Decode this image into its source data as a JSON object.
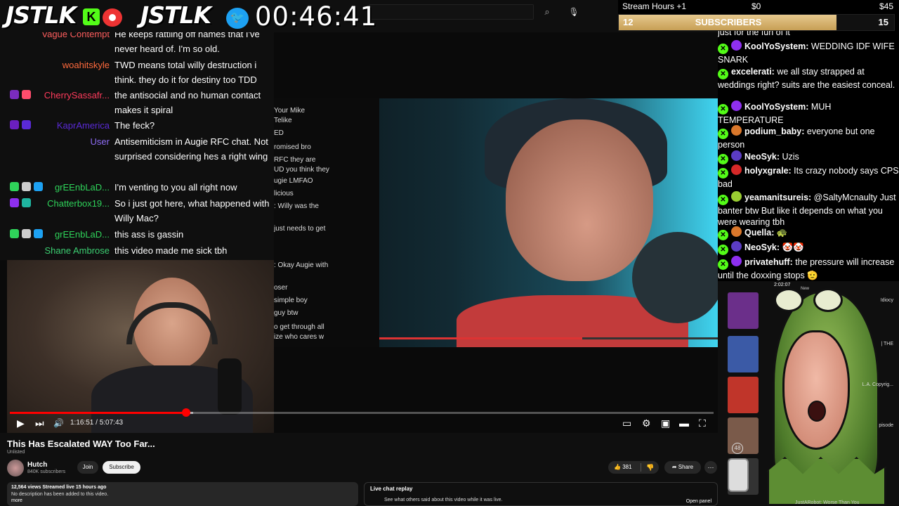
{
  "brand": {
    "left": "JSTLK",
    "right": "JSTLK",
    "kick_letter": "K",
    "twitter_bird": "🐦"
  },
  "timer": "00:46:41",
  "stream_widget": {
    "label": "Stream Hours +1",
    "min": "$0",
    "max": "$45",
    "subs_current": "12",
    "subs_label": "SUBSCRIBERS",
    "subs_goal": "15",
    "subs_progress": 0.79
  },
  "overlay_chat": [
    {
      "user": "Vague Contempt",
      "color": "#ff5e5e",
      "text": "He keeps rattling off names that I've never heard of. I'm so old.",
      "badges": []
    },
    {
      "user": "woahitskyle",
      "color": "#ff6a3d",
      "text": "TWD means total willy destruction i think. they do it for destiny too TDD",
      "badges": []
    },
    {
      "user": "CherrySassafr...",
      "color": "#ff3b5c",
      "text": "the antisocial and no human contact makes it spiral",
      "badges": [
        "#7b2cbf",
        "#ff4d6d"
      ]
    },
    {
      "user": "KaprAmerica",
      "color": "#5a2ad6",
      "text": "The feck?",
      "badges": [
        "#6a1fbf",
        "#5a2ad6"
      ]
    },
    {
      "user": "User",
      "color": "#8e6cf5",
      "text": "Antisemiticism in Augie RFC chat. Not surprised considering hes a right wing",
      "badges": []
    },
    {
      "user": "grEEnbLaD...",
      "color": "#2fd35a",
      "text": "I'm venting to you all right now",
      "badges": [
        "#2fd35a",
        "#cccccc",
        "#1da1f2"
      ]
    },
    {
      "user": "Chatterbox19...",
      "color": "#2fd35a",
      "text": "So i just got here, what happened with Willy Mac?",
      "badges": [
        "#8e2ff0",
        "#1fb5a0"
      ]
    },
    {
      "user": "grEEnbLaD...",
      "color": "#2fd35a",
      "text": "this ass is gassin",
      "badges": [
        "#2fd35a",
        "#cccccc",
        "#1da1f2"
      ]
    },
    {
      "user": "Shane Ambrose",
      "color": "#3ccf72",
      "text": "this video made me sick tbh",
      "badges": []
    }
  ],
  "video_panel_lines": [
    "Your Mike",
    "Telike",
    "ED",
    "romised bro",
    "RFC they are",
    "UD you think they",
    "ugie LMFAO",
    "licious",
    ": Willy was the",
    "just needs to get",
    ": Okay Augie with",
    "oser",
    "simple boy",
    "guy btw",
    "o get through all",
    "ize who cares w"
  ],
  "player": {
    "time": "1:16:51 / 5:07:43",
    "progress": 0.25,
    "buffered": 0.26,
    "title": "This Has Escalated WAY Too Far...",
    "unlisted": "Unlisted",
    "channel": "Hutch",
    "channel_subs": "840K subscribers",
    "join": "Join",
    "subscribe": "Subscribe",
    "likes": "381",
    "share": "Share",
    "views": "12,564 views  Streamed live 15 hours ago",
    "description": "No description has been added to this video.",
    "more": "more",
    "replay_title": "Live chat replay",
    "replay_text": "See what others said about this video while it was live.",
    "replay_open": "Open panel"
  },
  "right_chat": [
    {
      "user": "",
      "color": "#ffffff",
      "text": "just for the fun of it",
      "dot": "",
      "kick": false
    },
    {
      "user": "KoolYoSystem:",
      "color": "#ffffff",
      "text": "WEDDING IDF WIFE SNARK",
      "dot": "#8e2ff0",
      "kick": true
    },
    {
      "user": "excelerati:",
      "color": "#ffffff",
      "text": "we all stay strapped at weddings right? suits are the easiest conceal.",
      "dot": "",
      "kick": true
    },
    {
      "user": "KoolYoSystem:",
      "color": "#ffffff",
      "text": "MUH TEMPERATURE",
      "dot": "#8e2ff0",
      "kick": true
    },
    {
      "user": "podium_baby:",
      "color": "#ffffff",
      "text": "everyone but one person",
      "dot": "#d9772b",
      "kick": true
    },
    {
      "user": "NeoSyk:",
      "color": "#ffffff",
      "text": "Uzis",
      "dot": "#5b3cc4",
      "kick": true
    },
    {
      "user": "holyxgrale:",
      "color": "#ffffff",
      "text": "Its crazy nobody says CPS bad",
      "dot": "#d62828",
      "kick": true
    },
    {
      "user": "yeamanitsureis:",
      "color": "#ffffff",
      "text": "@SaltyMcnaulty Just banter btw But like it depends on what you were wearing tbh",
      "dot": "#9acd32",
      "kick": true
    },
    {
      "user": "Quella:",
      "color": "#ffffff",
      "text": "🐢",
      "dot": "#d9772b",
      "kick": true
    },
    {
      "user": "NeoSyk:",
      "color": "#ffffff",
      "text": "🤡🤡",
      "dot": "#5b3cc4",
      "kick": true
    },
    {
      "user": "privatehuff:",
      "color": "#ffffff",
      "text": "the pressure will increase until the doxxing stops 🫡",
      "dot": "#8e2ff0",
      "kick": true
    }
  ],
  "recs": [
    {
      "title": "Idiocy",
      "color": "#6b2f8a"
    },
    {
      "title": "| THE",
      "color": "#3b5aa6"
    },
    {
      "title": "L.A. Copyrig...",
      "color": "#c0352a"
    },
    {
      "title": "pisode",
      "color": "#7a5a4a"
    },
    {
      "title": "",
      "color": "#333"
    }
  ],
  "recs_misc": {
    "time": "2:02:07",
    "new": "New",
    "bottom": "JustARobot: Worse Than You",
    "badge48": "48"
  },
  "icons": {
    "search": "⌕",
    "mic": "🎙",
    "play": "▶",
    "next": "⏭",
    "volume": "🔊",
    "captions": "▭",
    "settings": "⚙",
    "miniplayer": "▣",
    "theater": "▬",
    "fullscreen": "⛶",
    "like": "👍",
    "dislike": "👎",
    "share": "➦",
    "more": "⋯"
  }
}
